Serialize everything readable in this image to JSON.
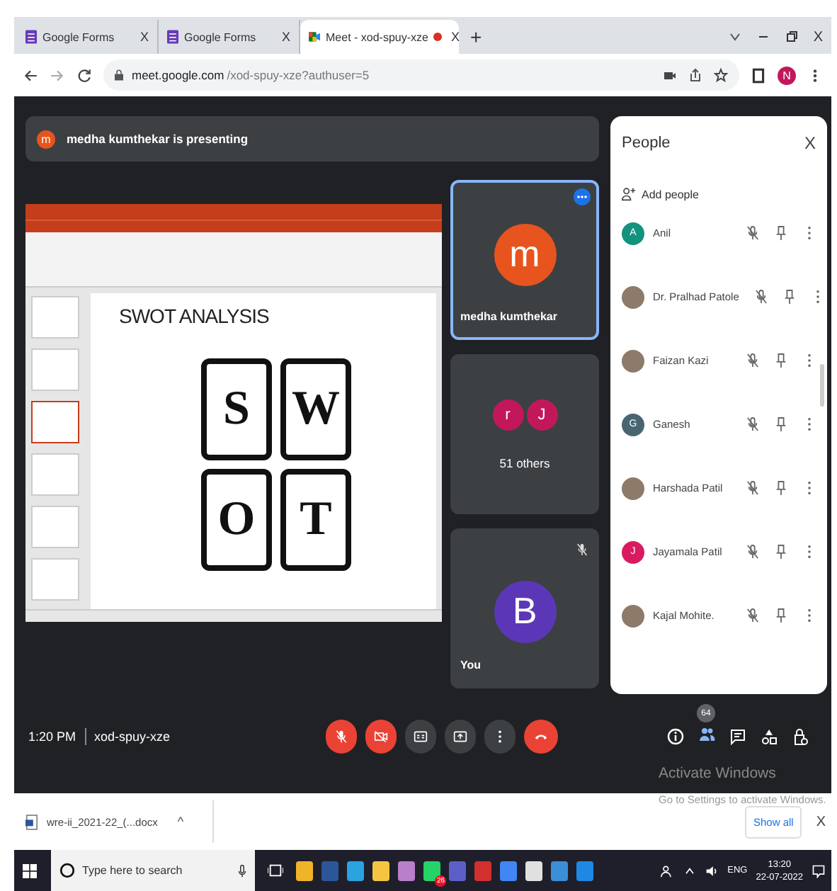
{
  "browser": {
    "tabs": [
      {
        "title": "Google Forms",
        "close": "X",
        "selected": false,
        "kind": "forms"
      },
      {
        "title": "Google Forms",
        "close": "X",
        "selected": false,
        "kind": "forms"
      },
      {
        "title": "Meet - xod-spuy-xze",
        "close": "X",
        "selected": true,
        "kind": "meet",
        "recording": true
      }
    ],
    "new_tab": "+",
    "window_close": "X",
    "url_host": "meet.google.com",
    "url_path": "/xod-spuy-xze?authuser=5",
    "profile": "N"
  },
  "meet": {
    "banner": {
      "initial": "m",
      "text": "medha kumthekar is presenting"
    },
    "slide": {
      "title": "SWOT ANALYSIS",
      "letters": [
        "S",
        "W",
        "O",
        "T"
      ]
    },
    "tiles": [
      {
        "kind": "speaker",
        "initial": "m",
        "name": "medha kumthekar",
        "color": "#e8541e",
        "speaking": true
      },
      {
        "kind": "group",
        "initials": [
          "r",
          "J"
        ],
        "label": "51 others",
        "color": "#c2185b"
      },
      {
        "kind": "self",
        "initial": "B",
        "name": "You",
        "color": "#5b37b8",
        "muted": true
      }
    ],
    "people": {
      "title": "People",
      "close": "X",
      "add": "Add people",
      "members": [
        {
          "name": "Anil",
          "kind": "letter",
          "initial": "A",
          "color": "#12927f"
        },
        {
          "name": "Dr. Pralhad Patole",
          "kind": "photo"
        },
        {
          "name": "Faizan Kazi",
          "kind": "photo"
        },
        {
          "name": "Ganesh",
          "kind": "letter",
          "initial": "G",
          "color": "#4a6572"
        },
        {
          "name": "Harshada Patil",
          "kind": "photo"
        },
        {
          "name": "Jayamala Patil",
          "kind": "letter",
          "initial": "J",
          "color": "#d81b60"
        },
        {
          "name": "Kajal Mohite.",
          "kind": "photo"
        }
      ]
    },
    "bar": {
      "time": "1:20 PM",
      "code": "xod-spuy-xze",
      "people_count": "64",
      "controls": [
        {
          "kind": "mic",
          "off": true
        },
        {
          "kind": "camera",
          "off": true
        },
        {
          "kind": "captions",
          "off": false
        },
        {
          "kind": "present",
          "off": false
        },
        {
          "kind": "more",
          "off": false
        },
        {
          "kind": "end",
          "off": true
        }
      ]
    }
  },
  "activation": {
    "title": "Activate Windows",
    "text": "Go to Settings to activate Windows."
  },
  "download": {
    "file": "wre-ii_2021-22_(...docx",
    "caret": "^",
    "show_all": "Show all",
    "close": "X"
  },
  "taskbar": {
    "search_placeholder": "Type here to search",
    "apps": [
      {
        "color": "#f0b429"
      },
      {
        "color": "#2b579a"
      },
      {
        "color": "#2aa3e0"
      },
      {
        "color": "#f5c542"
      },
      {
        "color": "#b97fc9"
      },
      {
        "color": "#25d366",
        "badge": "26"
      },
      {
        "color": "#5b5fc7"
      },
      {
        "color": "#d32f2f"
      },
      {
        "color": "#4285f4"
      },
      {
        "color": "#e0e0e0"
      },
      {
        "color": "#3a8fd6"
      },
      {
        "color": "#1e88e5"
      }
    ],
    "lang": "ENG",
    "time": "13:20",
    "date": "22-07-2022"
  }
}
